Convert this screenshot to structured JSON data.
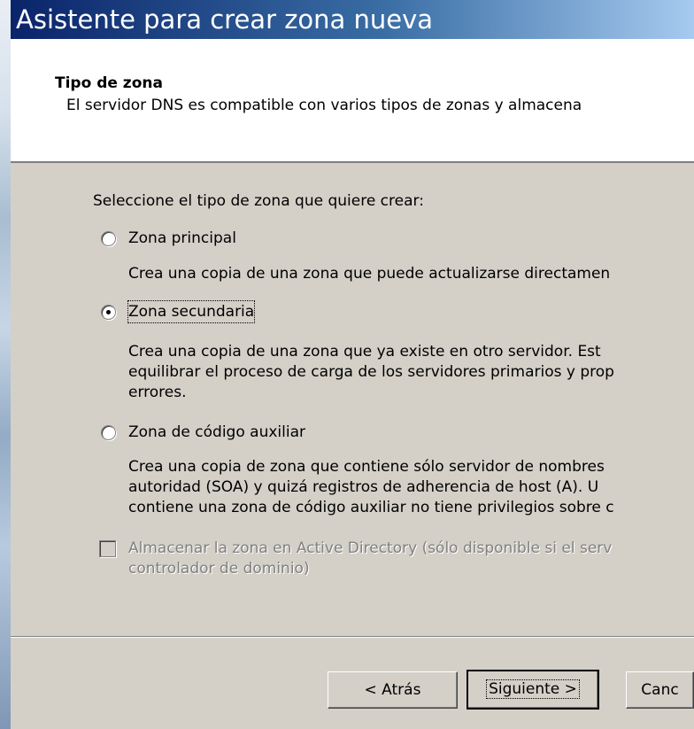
{
  "window": {
    "title": "Asistente para crear zona nueva"
  },
  "header": {
    "title": "Tipo de zona",
    "description": "El servidor DNS es compatible con varios tipos de zonas y almacena"
  },
  "content": {
    "prompt": "Seleccione el tipo de zona que quiere crear:",
    "options": [
      {
        "label": "Zona principal",
        "selected": false,
        "description": [
          "Crea una copia de una zona que puede actualizarse directamen"
        ]
      },
      {
        "label": "Zona secundaria",
        "selected": true,
        "description": [
          "Crea una copia de una zona que ya existe en otro servidor. Est",
          "equilibrar el proceso de carga de los servidores primarios y prop",
          "errores."
        ]
      },
      {
        "label": "Zona de código auxiliar",
        "selected": false,
        "description": [
          "Crea una copia de zona que contiene sólo servidor de nombres",
          "autoridad (SOA) y quizá registros de adherencia de host (A). U",
          "contiene una zona de código auxiliar no tiene privilegios sobre c"
        ]
      }
    ],
    "ad_checkbox": {
      "checked": false,
      "enabled": false,
      "label_lines": [
        "Almacenar la zona en Active Directory (sólo disponible si el serv",
        "controlador de dominio)"
      ]
    }
  },
  "buttons": {
    "back": "< Atrás",
    "next": "Siguiente >",
    "cancel": "Canc"
  }
}
